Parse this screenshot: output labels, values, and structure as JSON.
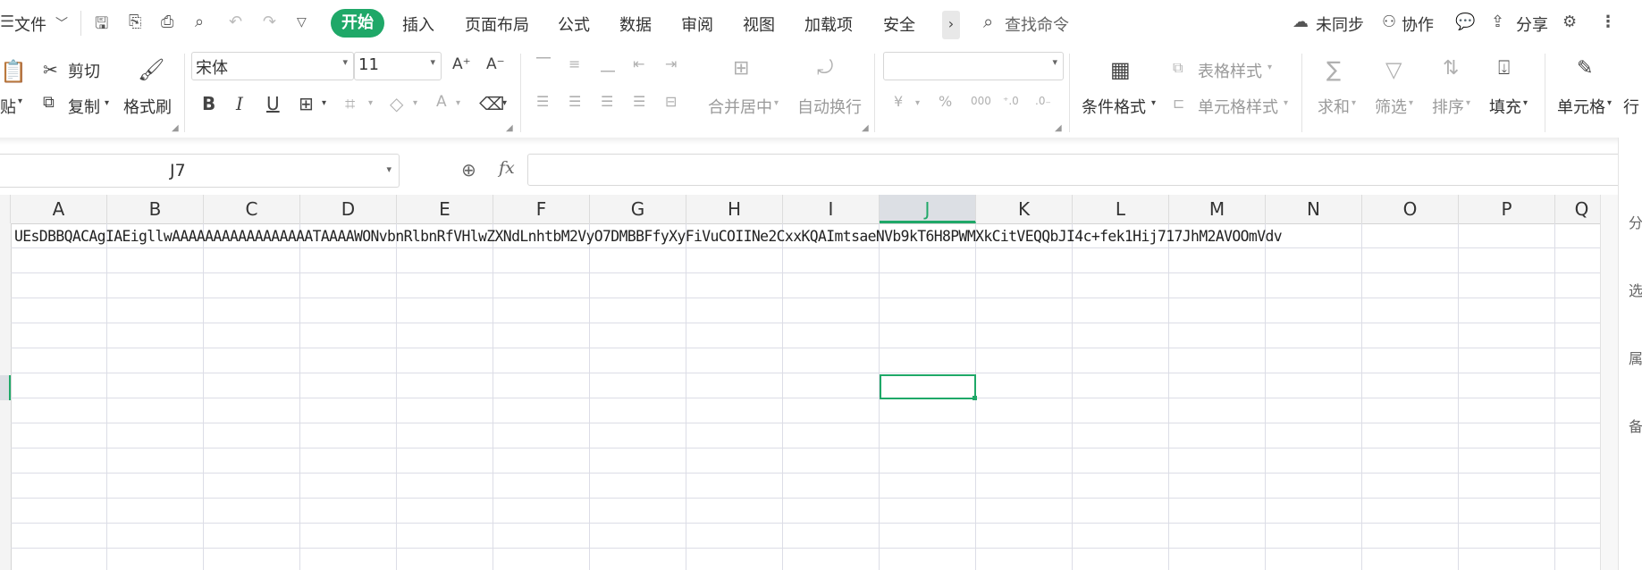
{
  "menubar": {
    "file_label": "文件",
    "tabs": [
      "开始",
      "插入",
      "页面布局",
      "公式",
      "数据",
      "审阅",
      "视图",
      "加载项",
      "安全"
    ],
    "search_label": "查找命令",
    "sync_label": "未同步",
    "collab_label": "协作",
    "share_label": "分享"
  },
  "ribbon": {
    "paste_label": "贴",
    "cut_label": "剪切",
    "copy_label": "复制",
    "format_painter_label": "格式刷",
    "font_name": "宋体",
    "font_size": "11",
    "merge_center_label": "合并居中",
    "wrap_text_label": "自动换行",
    "cond_format_label": "条件格式",
    "table_style_label": "表格样式",
    "cell_style_label": "单元格样式",
    "sum_label": "求和",
    "filter_label": "筛选",
    "sort_label": "排序",
    "fill_label": "填充",
    "cell_label": "单元格",
    "row_col_label": "行"
  },
  "formula_bar": {
    "name_box": "J7",
    "fx_label": "fx",
    "value": ""
  },
  "sheet": {
    "columns": [
      "A",
      "B",
      "C",
      "D",
      "E",
      "F",
      "G",
      "H",
      "I",
      "J",
      "K",
      "L",
      "M",
      "N",
      "O",
      "P",
      "Q"
    ],
    "selected_column": "J",
    "a1_text": "UEsDBBQACAgIAEigllwAAAAAAAAAAAAAAAAATAAAAWONvbnRlbnRfVHlwZXNdLnhtbM2VyO7DMBBFfyXyFiVuCOIINe2CxxKQAImtsaeNVb9kT6H8PWMXkCitVEQQbJI4c+fek1Hij717JhM2AVOOmVdv"
  },
  "right_pane": {
    "partial_labels": [
      "分",
      "选",
      "属",
      "备"
    ]
  },
  "colors": {
    "accent": "#1fa868",
    "grid_line": "#dcdde6"
  }
}
